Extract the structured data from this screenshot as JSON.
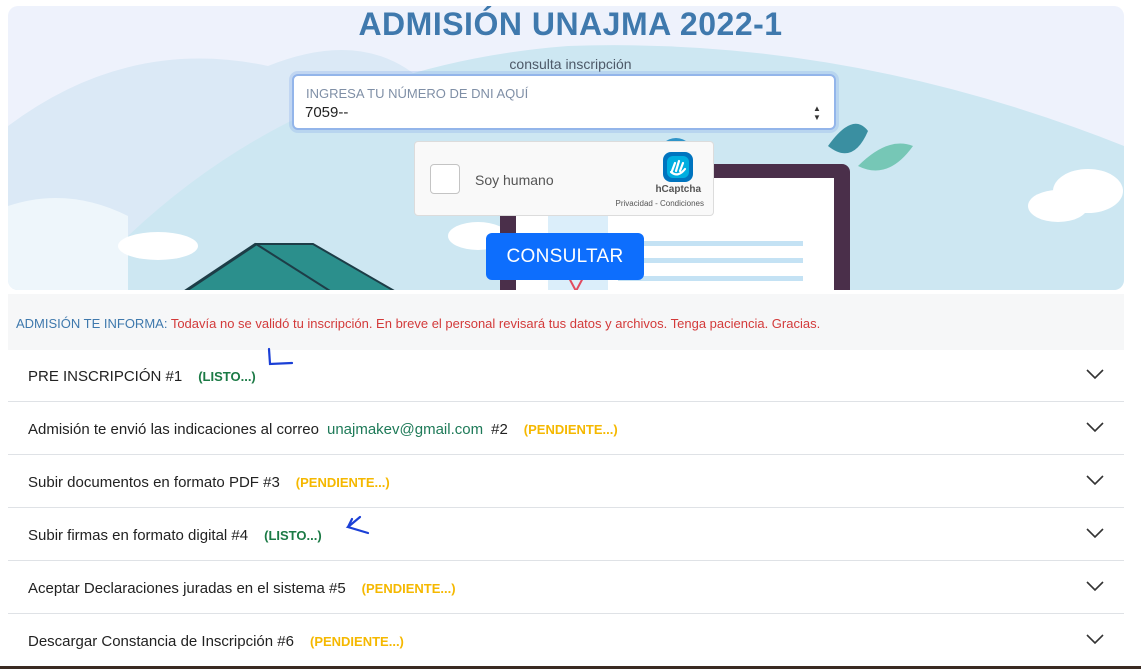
{
  "header": {
    "title": "ADMISIÓN UNAJMA 2022-1",
    "subtitle": "consulta inscripción"
  },
  "dni": {
    "label": "INGRESA TU NÚMERO DE DNI AQUÍ",
    "value": "7059--"
  },
  "captcha": {
    "label": "Soy humano",
    "brand": "hCaptcha",
    "privacy": "Privacidad",
    "separator": " - ",
    "terms": "Condiciones",
    "checked": false
  },
  "consultar_label": "CONSULTAR",
  "info": {
    "label": "ADMISIÓN TE INFORMA:",
    "message": "Todavía no se validó tu inscripción. En breve el personal revisará tus datos y archivos. Tenga paciencia. Gracias."
  },
  "steps": [
    {
      "text": "PRE INSCRIPCIÓN #1",
      "status": "(LISTO...)",
      "state": "listo"
    },
    {
      "text": "Admisión te envió las indicaciones al correo",
      "email": "unajmakev@gmail.com",
      "suffix": "#2",
      "status": "(PENDIENTE...)",
      "state": "pendiente"
    },
    {
      "text": "Subir documentos en formato PDF #3",
      "status": "(PENDIENTE...)",
      "state": "pendiente"
    },
    {
      "text": "Subir firmas en formato digital #4",
      "status": "(LISTO...)",
      "state": "listo"
    },
    {
      "text": "Aceptar Declaraciones juradas en el sistema #5",
      "status": "(PENDIENTE...)",
      "state": "pendiente"
    },
    {
      "text": "Descargar Constancia de Inscripción #6",
      "status": "(PENDIENTE...)",
      "state": "pendiente"
    }
  ],
  "colors": {
    "title": "#3f79ad",
    "button": "#0d6efd",
    "listo": "#1b7a45",
    "pendiente": "#f5b800",
    "info_message": "#d33a3a",
    "email": "#1e7a58"
  },
  "icons": {
    "step_toggle": "chevron-down-icon",
    "captcha_logo": "hcaptcha-logo-icon",
    "annotation": "arrow-annotation-icon"
  }
}
